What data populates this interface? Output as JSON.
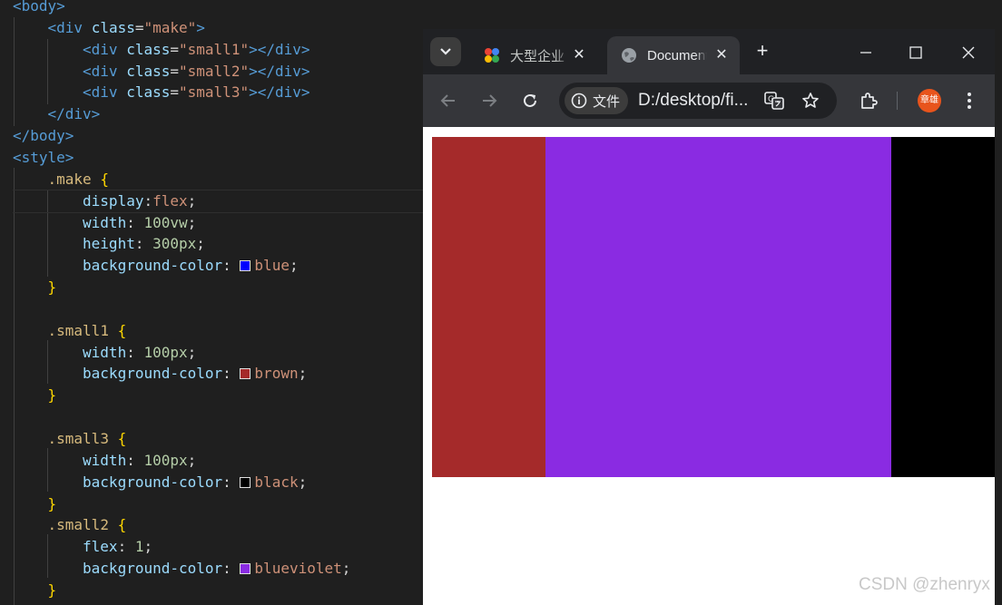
{
  "editor": {
    "lines": [
      {
        "parts": [
          {
            "c": "tag",
            "t": "<body>"
          }
        ]
      },
      {
        "parts": [
          {
            "c": "tag",
            "t": "<div"
          },
          {
            "c": "punc",
            "t": " "
          },
          {
            "c": "attr",
            "t": "class"
          },
          {
            "c": "punc",
            "t": "="
          },
          {
            "c": "str",
            "t": "\"make\""
          },
          {
            "c": "tag",
            "t": ">"
          }
        ]
      },
      {
        "parts": [
          {
            "c": "tag",
            "t": "<div"
          },
          {
            "c": "punc",
            "t": " "
          },
          {
            "c": "attr",
            "t": "class"
          },
          {
            "c": "punc",
            "t": "="
          },
          {
            "c": "str",
            "t": "\"small1\""
          },
          {
            "c": "tag",
            "t": "></div>"
          }
        ]
      },
      {
        "parts": [
          {
            "c": "tag",
            "t": "<div"
          },
          {
            "c": "punc",
            "t": " "
          },
          {
            "c": "attr",
            "t": "class"
          },
          {
            "c": "punc",
            "t": "="
          },
          {
            "c": "str",
            "t": "\"small2\""
          },
          {
            "c": "tag",
            "t": "></div>"
          }
        ]
      },
      {
        "parts": [
          {
            "c": "tag",
            "t": "<div"
          },
          {
            "c": "punc",
            "t": " "
          },
          {
            "c": "attr",
            "t": "class"
          },
          {
            "c": "punc",
            "t": "="
          },
          {
            "c": "str",
            "t": "\"small3\""
          },
          {
            "c": "tag",
            "t": "></div>"
          }
        ]
      },
      {
        "parts": [
          {
            "c": "tag",
            "t": "</div>"
          }
        ]
      },
      {
        "parts": [
          {
            "c": "tag",
            "t": "</body>"
          }
        ]
      },
      {
        "parts": [
          {
            "c": "tag",
            "t": "<style>"
          }
        ]
      },
      {
        "parts": [
          {
            "c": "sel",
            "t": ".make"
          },
          {
            "c": "punc",
            "t": " "
          },
          {
            "c": "brace",
            "t": "{"
          }
        ]
      },
      {
        "parts": [
          {
            "c": "prop",
            "t": "display"
          },
          {
            "c": "punc",
            "t": ":"
          },
          {
            "c": "kw",
            "t": "flex"
          },
          {
            "c": "punc",
            "t": ";"
          }
        ]
      },
      {
        "parts": [
          {
            "c": "prop",
            "t": "width"
          },
          {
            "c": "punc",
            "t": ": "
          },
          {
            "c": "num",
            "t": "100vw"
          },
          {
            "c": "punc",
            "t": ";"
          }
        ]
      },
      {
        "parts": [
          {
            "c": "prop",
            "t": "height"
          },
          {
            "c": "punc",
            "t": ": "
          },
          {
            "c": "num",
            "t": "300px"
          },
          {
            "c": "punc",
            "t": ";"
          }
        ]
      },
      {
        "parts": [
          {
            "c": "prop",
            "t": "background-color"
          },
          {
            "c": "punc",
            "t": ": "
          },
          {
            "c": "swatch",
            "t": "#0000ff"
          },
          {
            "c": "kw",
            "t": "blue"
          },
          {
            "c": "punc",
            "t": ";"
          }
        ]
      },
      {
        "parts": [
          {
            "c": "brace",
            "t": "}"
          }
        ]
      },
      {
        "parts": []
      },
      {
        "parts": [
          {
            "c": "sel",
            "t": ".small1"
          },
          {
            "c": "punc",
            "t": " "
          },
          {
            "c": "brace",
            "t": "{"
          }
        ]
      },
      {
        "parts": [
          {
            "c": "prop",
            "t": "width"
          },
          {
            "c": "punc",
            "t": ": "
          },
          {
            "c": "num",
            "t": "100px"
          },
          {
            "c": "punc",
            "t": ";"
          }
        ]
      },
      {
        "parts": [
          {
            "c": "prop",
            "t": "background-color"
          },
          {
            "c": "punc",
            "t": ": "
          },
          {
            "c": "swatch",
            "t": "#a52a2a"
          },
          {
            "c": "kw",
            "t": "brown"
          },
          {
            "c": "punc",
            "t": ";"
          }
        ]
      },
      {
        "parts": [
          {
            "c": "brace",
            "t": "}"
          }
        ]
      },
      {
        "parts": []
      },
      {
        "parts": [
          {
            "c": "sel",
            "t": ".small3"
          },
          {
            "c": "punc",
            "t": " "
          },
          {
            "c": "brace",
            "t": "{"
          }
        ]
      },
      {
        "parts": [
          {
            "c": "prop",
            "t": "width"
          },
          {
            "c": "punc",
            "t": ": "
          },
          {
            "c": "num",
            "t": "100px"
          },
          {
            "c": "punc",
            "t": ";"
          }
        ]
      },
      {
        "parts": [
          {
            "c": "prop",
            "t": "background-color"
          },
          {
            "c": "punc",
            "t": ": "
          },
          {
            "c": "swatch",
            "t": "#000000"
          },
          {
            "c": "kw",
            "t": "black"
          },
          {
            "c": "punc",
            "t": ";"
          }
        ]
      },
      {
        "parts": [
          {
            "c": "brace",
            "t": "}"
          }
        ]
      },
      {
        "parts": [
          {
            "c": "sel",
            "t": ".small2"
          },
          {
            "c": "punc",
            "t": " "
          },
          {
            "c": "brace",
            "t": "{"
          }
        ]
      },
      {
        "parts": [
          {
            "c": "prop",
            "t": "flex"
          },
          {
            "c": "punc",
            "t": ": "
          },
          {
            "c": "num",
            "t": "1"
          },
          {
            "c": "punc",
            "t": ";"
          }
        ]
      },
      {
        "parts": [
          {
            "c": "prop",
            "t": "background-color"
          },
          {
            "c": "punc",
            "t": ": "
          },
          {
            "c": "swatch",
            "t": "#8a2be2"
          },
          {
            "c": "kw",
            "t": "blueviolet"
          },
          {
            "c": "punc",
            "t": ";"
          }
        ]
      },
      {
        "parts": [
          {
            "c": "brace",
            "t": "}"
          }
        ]
      }
    ]
  },
  "browser": {
    "tabs": [
      {
        "title": "大型企业",
        "icon": "multicolor-app-icon",
        "active": false
      },
      {
        "title": "Document",
        "icon": "globe-icon",
        "active": true
      }
    ],
    "omnibox": {
      "chip_label": "文件",
      "url": "D:/desktop/fi..."
    },
    "profile_label": "章雄",
    "page": {
      "container_color": "#0000ff",
      "boxes": [
        {
          "name": "small1",
          "color": "#a52a2a"
        },
        {
          "name": "small2",
          "color": "#8a2be2"
        },
        {
          "name": "small3",
          "color": "#000000"
        }
      ]
    }
  },
  "watermark": "CSDN @zhenryx"
}
